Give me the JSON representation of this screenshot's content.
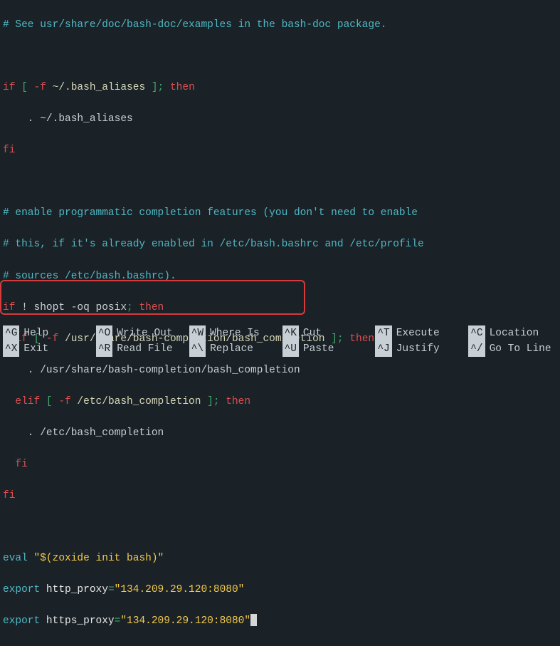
{
  "code": {
    "l1": "# See usr/share/doc/bash-doc/examples in the bash-doc package.",
    "l3_if": "if",
    "l3_br": " [ ",
    "l3_flag": "-f",
    "l3_path": " ~/.bash_aliases",
    "l3_close": " ]; ",
    "l3_then": "then",
    "l4": "    . ~/.bash_aliases",
    "l5": "fi",
    "l7": "# enable programmatic completion features (you don't need to enable",
    "l8": "# this, if it's already enabled in /etc/bash.bashrc and /etc/profile",
    "l9": "# sources /etc/bash.bashrc).",
    "l10_if": "if",
    "l10_bang": " ! ",
    "l10_cmd": "shopt -oq posix",
    "l10_semi": "; ",
    "l10_then": "then",
    "l11_if": "  if",
    "l11_br": " [ ",
    "l11_flag": "-f",
    "l11_path": " /usr/share/bash-completion/bash_completion",
    "l11_close": " ]; ",
    "l11_then": "then",
    "l12": "    . /usr/share/bash-completion/bash_completion",
    "l13_elif": "  elif",
    "l13_br": " [ ",
    "l13_flag": "-f",
    "l13_path": " /etc/bash_completion",
    "l13_close": " ]; ",
    "l13_then": "then",
    "l14": "    . /etc/bash_completion",
    "l15": "  fi",
    "l16": "fi",
    "l18_eval": "eval ",
    "l18_str": "\"$(zoxide init bash)\"",
    "l19_kw": "export",
    "l19_var": " http_proxy",
    "l19_eq": "=",
    "l19_val": "\"134.209.29.120:8080\"",
    "l20_kw": "export",
    "l20_var": " https_proxy",
    "l20_eq": "=",
    "l20_val": "\"134.209.29.120:8080\""
  },
  "shortcuts": [
    {
      "key": "^G",
      "label": "Help"
    },
    {
      "key": "^O",
      "label": "Write Out"
    },
    {
      "key": "^W",
      "label": "Where Is"
    },
    {
      "key": "^K",
      "label": "Cut"
    },
    {
      "key": "^T",
      "label": "Execute"
    },
    {
      "key": "^C",
      "label": "Location"
    },
    {
      "key": "^X",
      "label": "Exit"
    },
    {
      "key": "^R",
      "label": "Read File"
    },
    {
      "key": "^\\",
      "label": "Replace"
    },
    {
      "key": "^U",
      "label": "Paste"
    },
    {
      "key": "^J",
      "label": "Justify"
    },
    {
      "key": "^/",
      "label": "Go To Line"
    }
  ]
}
